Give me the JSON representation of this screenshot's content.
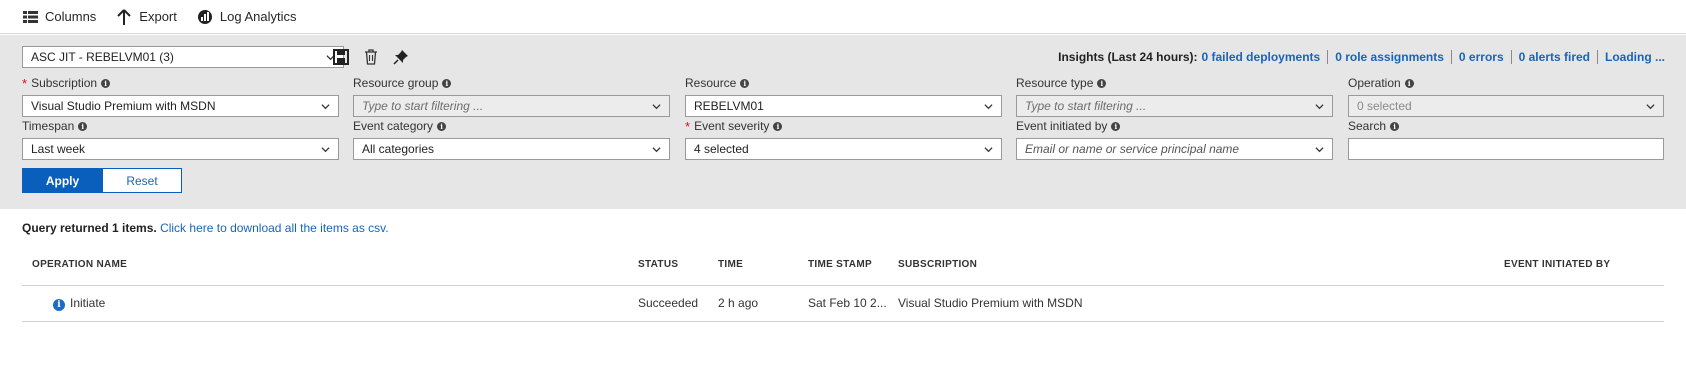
{
  "toolbar": {
    "columns_label": "Columns",
    "export_label": "Export",
    "log_analytics_label": "Log Analytics"
  },
  "filters": {
    "preset": "ASC JIT - REBELVM01 (3)",
    "insights": {
      "title": "Insights (Last 24 hours):",
      "failed_deployments": "0 failed deployments",
      "role_assignments": "0 role assignments",
      "errors": "0 errors",
      "alerts_fired": "0 alerts fired",
      "loading": "Loading ..."
    },
    "subscription": {
      "label": "Subscription",
      "value": "Visual Studio Premium with MSDN"
    },
    "resource_group": {
      "label": "Resource group",
      "placeholder": "Type to start filtering ..."
    },
    "resource": {
      "label": "Resource",
      "value": "REBELVM01"
    },
    "resource_type": {
      "label": "Resource type",
      "placeholder": "Type to start filtering ..."
    },
    "operation": {
      "label": "Operation",
      "value": "0 selected"
    },
    "timespan": {
      "label": "Timespan",
      "value": "Last week"
    },
    "event_category": {
      "label": "Event category",
      "value": "All categories"
    },
    "event_severity": {
      "label": "Event severity",
      "value": "4 selected"
    },
    "event_initiated_by": {
      "label": "Event initiated by",
      "placeholder": "Email or name or service principal name"
    },
    "search": {
      "label": "Search",
      "value": ""
    },
    "required_marker": "*",
    "info_glyph": "i",
    "apply_label": "Apply",
    "reset_label": "Reset"
  },
  "results": {
    "summary_bold": "Query returned 1 items.",
    "download_link": "Click here to download all the items as csv.",
    "columns": {
      "operation_name": "OPERATION NAME",
      "status": "STATUS",
      "time": "TIME",
      "time_stamp": "TIME STAMP",
      "subscription": "SUBSCRIPTION",
      "event_initiated_by": "EVENT INITIATED BY"
    },
    "rows": [
      {
        "operation_name": "Initiate",
        "status": "Succeeded",
        "time": "2 h ago",
        "time_stamp": "Sat Feb 10 2...",
        "subscription": "Visual Studio Premium with MSDN",
        "event_initiated_by": ""
      }
    ]
  },
  "icons": {
    "columns": "columns-icon",
    "export": "export-arrow-icon",
    "log_analytics": "log-analytics-icon",
    "save": "save-icon",
    "delete": "trash-icon",
    "pin": "pin-icon",
    "info": "info-icon",
    "chevron": "chevron-down-icon"
  },
  "colors": {
    "accent": "#0a5ebc",
    "link": "#1865b8",
    "required": "#e00b1c",
    "panel_bg": "#e6e6e6"
  }
}
